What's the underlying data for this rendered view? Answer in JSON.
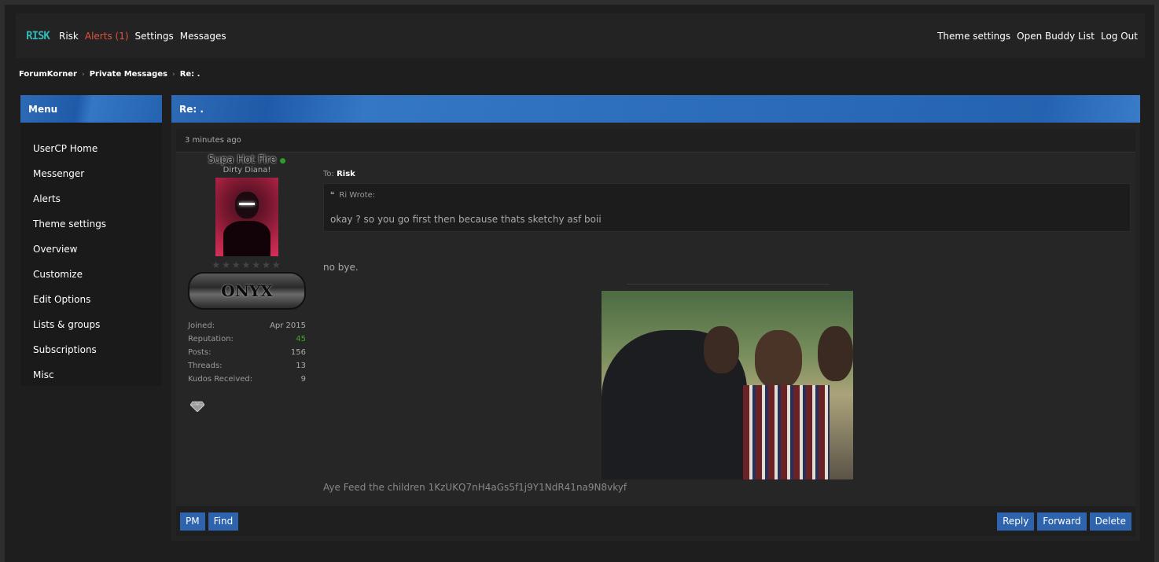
{
  "header": {
    "logo_text": "RISK",
    "nav_left": [
      "Risk",
      "Alerts (1)",
      "Settings",
      "Messages"
    ],
    "nav_right": [
      "Theme settings",
      "Open Buddy List",
      "Log Out"
    ]
  },
  "breadcrumb": [
    "ForumKorner",
    "Private Messages",
    "Re: ."
  ],
  "menu": {
    "title": "Menu",
    "items": [
      "UserCP Home",
      "Messenger",
      "Alerts",
      "Theme settings",
      "Overview",
      "Customize",
      "Edit Options",
      "Lists & groups",
      "Subscriptions",
      "Misc"
    ]
  },
  "thread": {
    "title": "Re: .",
    "post": {
      "time": "3 minutes ago",
      "user": {
        "name": "Supa Hot Fire",
        "title": "Dirty Diana!",
        "stars": "★★★★★★★",
        "badge": "ONYX",
        "stats": [
          {
            "label": "Joined:",
            "value": "Apr 2015"
          },
          {
            "label": "Reputation:",
            "value": "45"
          },
          {
            "label": "Posts:",
            "value": "156"
          },
          {
            "label": "Threads:",
            "value": "13"
          },
          {
            "label": "Kudos Received:",
            "value": "9"
          }
        ]
      },
      "to_label": "To:",
      "to_name": "Risk",
      "quote": {
        "author": "Ri Wrote:",
        "text": "okay ? so you go first then because thats sketchy asf boii"
      },
      "message": "no bye.",
      "signature": "Aye Feed the children 1KzUKQ7nH4aGs5f1j9Y1NdR41na9N8vkyf"
    }
  },
  "buttons": {
    "left": [
      "PM",
      "Find"
    ],
    "right": [
      "Reply",
      "Forward",
      "Delete"
    ]
  },
  "colors": {
    "accent": "#2d64ad",
    "alert": "#e0533d",
    "reputation": "#44a531"
  }
}
